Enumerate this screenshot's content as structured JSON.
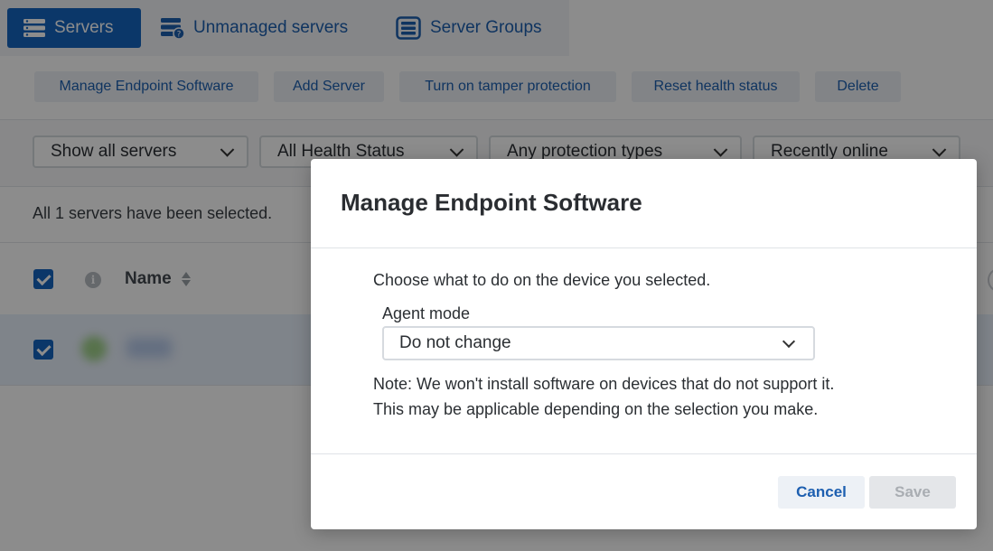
{
  "tabs": [
    {
      "label": "Servers",
      "icon": "servers-icon",
      "active": true
    },
    {
      "label": "Unmanaged servers",
      "icon": "unmanaged-servers-icon",
      "active": false
    },
    {
      "label": "Server Groups",
      "icon": "server-groups-icon",
      "active": false
    }
  ],
  "actions": [
    {
      "label": "Manage Endpoint Software"
    },
    {
      "label": "Add Server"
    },
    {
      "label": "Turn on tamper protection"
    },
    {
      "label": "Reset health status"
    },
    {
      "label": "Delete"
    }
  ],
  "filters": [
    {
      "value": "Show all servers"
    },
    {
      "value": "All Health Status"
    },
    {
      "value": "Any protection types"
    },
    {
      "value": "Recently online"
    }
  ],
  "selection_info": "All 1 servers have been selected.",
  "table": {
    "name_header": "Name",
    "header_checked": true,
    "row_checked": true
  },
  "modal": {
    "title": "Manage Endpoint Software",
    "instruction": "Choose what to do on the device you selected.",
    "agent_mode_label": "Agent mode",
    "agent_mode_value": "Do not change",
    "note_line1": "Note: We won't install software on devices that do not support it.",
    "note_line2": "This may be applicable depending on the selection you make.",
    "cancel_label": "Cancel",
    "save_label": "Save"
  },
  "colors": {
    "accent": "#1565c0",
    "link": "#1d5fb0",
    "overlay": "rgba(0,0,0,0.45)"
  }
}
